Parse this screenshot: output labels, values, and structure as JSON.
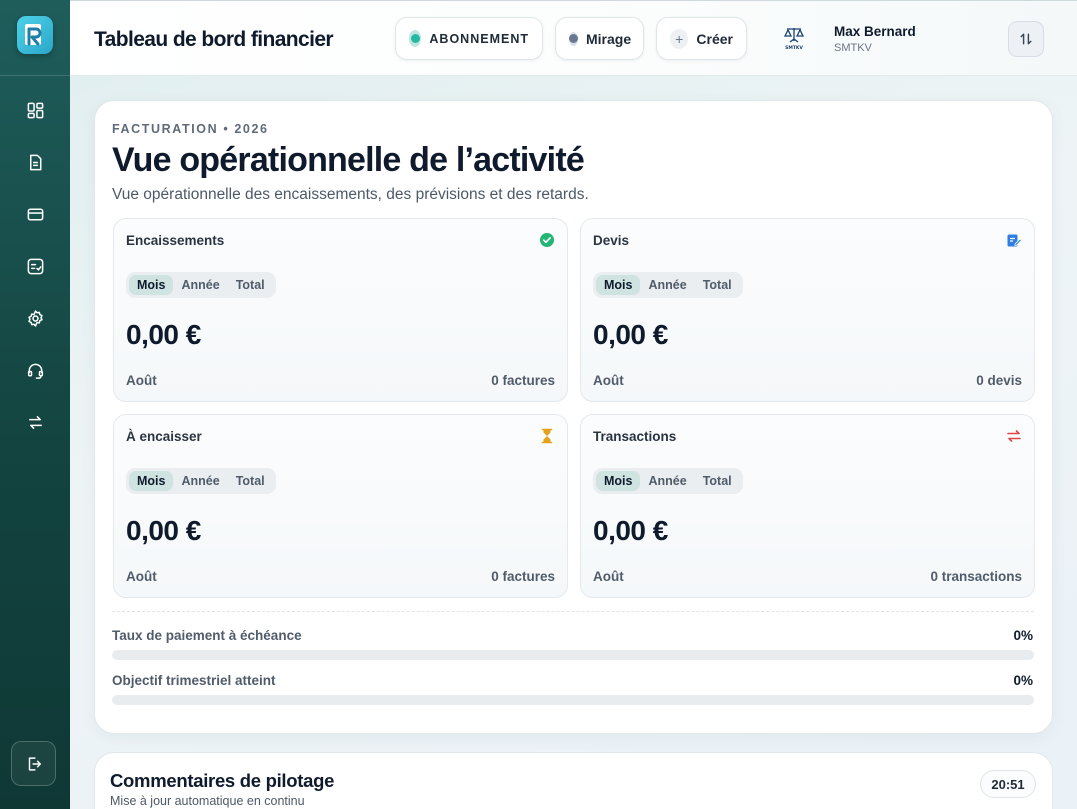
{
  "sidebar": {
    "logo_icon": "app-logo-icon",
    "items": [
      {
        "name": "dashboard",
        "icon": "dashboard-icon"
      },
      {
        "name": "documents",
        "icon": "document-icon"
      },
      {
        "name": "payments",
        "icon": "credit-card-icon"
      },
      {
        "name": "expenses",
        "icon": "receipt-icon"
      },
      {
        "name": "settings",
        "icon": "gear-icon"
      },
      {
        "name": "support",
        "icon": "headset-icon"
      },
      {
        "name": "transfers",
        "icon": "swap-arrows-icon"
      }
    ],
    "logout_icon": "logout-icon"
  },
  "topbar": {
    "title": "Tableau de bord financier",
    "subscription_label": "ABONNEMENT",
    "workspace_label": "Mirage",
    "create_label": "Créer",
    "create_icon": "+",
    "user": {
      "name": "Max Bernard",
      "org": "SMTKV"
    },
    "colors": {
      "accent": "#25b9a4",
      "sidebar": "#134440"
    }
  },
  "overview": {
    "eyebrow": "FACTURATION • 2026",
    "headline": "Vue opérationnelle de l’activité",
    "subtitle": "Vue opérationnelle des encaissements, des prévisions et des retards.",
    "cards": [
      {
        "title": "Encaissements",
        "icon": "check-circle-icon",
        "tabs": [
          "Mois",
          "Année",
          "Total"
        ],
        "active_tab": "Mois",
        "amount": "0,00 €",
        "period": "Août",
        "count": "0 factures"
      },
      {
        "title": "Devis",
        "icon": "edit-document-icon",
        "tabs": [
          "Mois",
          "Année",
          "Total"
        ],
        "active_tab": "Mois",
        "amount": "0,00 €",
        "period": "Août",
        "count": "0 devis"
      },
      {
        "title": "À encaisser",
        "icon": "hourglass-icon",
        "tabs": [
          "Mois",
          "Année",
          "Total"
        ],
        "active_tab": "Mois",
        "amount": "0,00 €",
        "period": "Août",
        "count": "0 factures"
      },
      {
        "title": "Transactions",
        "icon": "swap-arrows-icon",
        "tabs": [
          "Mois",
          "Année",
          "Total"
        ],
        "active_tab": "Mois",
        "amount": "0,00 €",
        "period": "Août",
        "count": "0 transactions"
      }
    ],
    "progress": [
      {
        "label": "Taux de paiement à échéance",
        "value": "0%",
        "fraction": 0
      },
      {
        "label": "Objectif trimestriel atteint",
        "value": "0%",
        "fraction": 0
      }
    ]
  },
  "comments": {
    "title": "Commentaires de pilotage",
    "subtitle": "Mise à jour automatique en continu",
    "time": "20:51"
  }
}
